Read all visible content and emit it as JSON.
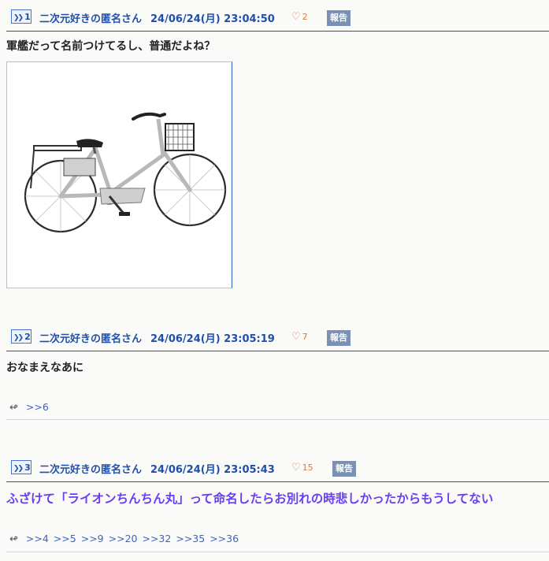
{
  "posts": [
    {
      "number": "1",
      "author": "二次元好きの匿名さん",
      "date": "24/06/24(月) 23:04:50",
      "likes": "2",
      "report": "報告",
      "text": "軍艦だって名前つけてるし、普通だよね？",
      "replies": []
    },
    {
      "number": "2",
      "author": "二次元好きの匿名さん",
      "date": "24/06/24(月) 23:05:19",
      "likes": "7",
      "report": "報告",
      "text": "おなまえなあに",
      "replies": [
        ">>6"
      ]
    },
    {
      "number": "3",
      "author": "二次元好きの匿名さん",
      "date": "24/06/24(月) 23:05:43",
      "likes": "15",
      "report": "報告",
      "text": "ふざけて「ライオンちんちん丸」って命名したらお別れの時悲しかったからもうしてない",
      "replies": [
        ">>4",
        ">>5",
        ">>9",
        ">>20",
        ">>32",
        ">>35",
        ">>36"
      ]
    }
  ],
  "colors": {
    "header_blue": "#1f4fa8",
    "like_orange": "#e07b3a",
    "report_bg": "#7a90b4",
    "highlight_purple": "#6a3ff2"
  },
  "icons": [
    "reply-arrow-icon",
    "heart-icon",
    "double-chevron-icon"
  ]
}
